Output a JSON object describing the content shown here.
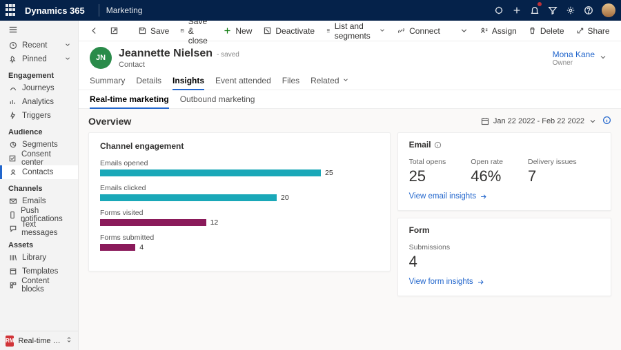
{
  "header": {
    "brand": "Dynamics 365",
    "area": "Marketing"
  },
  "sidebar": {
    "recent": "Recent",
    "pinned": "Pinned",
    "groups": {
      "engagement": "Engagement",
      "audience": "Audience",
      "channels": "Channels",
      "assets": "Assets"
    },
    "items": {
      "journeys": "Journeys",
      "analytics": "Analytics",
      "triggers": "Triggers",
      "segments": "Segments",
      "consent": "Consent center",
      "contacts": "Contacts",
      "emails": "Emails",
      "push": "Push notifications",
      "texts": "Text messages",
      "library": "Library",
      "templates": "Templates",
      "blocks": "Content blocks"
    },
    "area_switch": {
      "badge": "RM",
      "label": "Real-time marketi.."
    }
  },
  "cmdbar": {
    "save": "Save",
    "save_close": "Save & close",
    "new": "New",
    "deactivate": "Deactivate",
    "list_segments": "List and segments",
    "connect": "Connect",
    "assign": "Assign",
    "delete": "Delete",
    "share": "Share"
  },
  "record": {
    "initials": "JN",
    "name": "Jeannette Nielsen",
    "saved": "- saved",
    "entity": "Contact",
    "owner_name": "Mona Kane",
    "owner_role": "Owner"
  },
  "tabs": {
    "summary": "Summary",
    "details": "Details",
    "insights": "Insights",
    "events": "Event attended",
    "files": "Files",
    "related": "Related"
  },
  "subtabs": {
    "rtm": "Real-time marketing",
    "obm": "Outbound marketing"
  },
  "overview": {
    "title": "Overview",
    "date_range": "Jan 22 2022 - Feb 22 2022"
  },
  "channel_card": {
    "title": "Channel engagement"
  },
  "email_card": {
    "title": "Email",
    "total_label": "Total opens",
    "rate_label": "Open rate",
    "issues_label": "Delivery issues",
    "total": "25",
    "rate": "46%",
    "issues": "7",
    "link": "View email insights"
  },
  "form_card": {
    "title": "Form",
    "sub_label": "Submissions",
    "sub": "4",
    "link": "View form insights"
  },
  "chart_data": {
    "type": "bar",
    "orientation": "horizontal",
    "categories": [
      "Emails opened",
      "Emails clicked",
      "Forms visited",
      "Forms submitted"
    ],
    "values": [
      25,
      20,
      12,
      4
    ],
    "colors": [
      "#1aa8b8",
      "#1aa8b8",
      "#8a1a5a",
      "#8a1a5a"
    ],
    "title": "Channel engagement"
  }
}
